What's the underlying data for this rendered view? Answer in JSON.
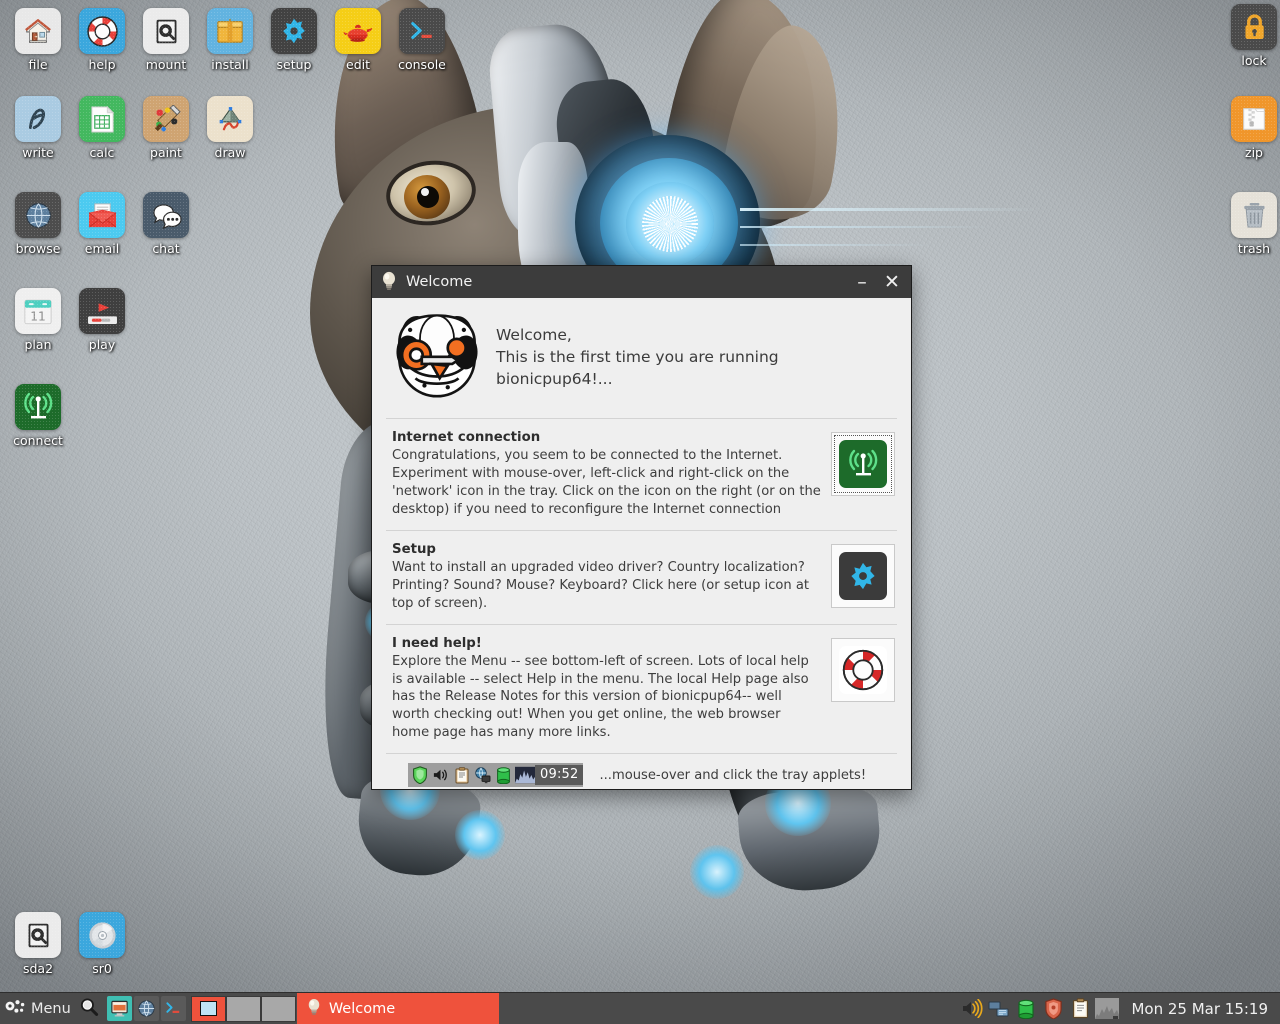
{
  "desktop": {
    "icons_left": [
      {
        "label": "file",
        "name": "desktop-icon-file",
        "icon": "home-icon",
        "bg": "#e8e8e8"
      },
      {
        "label": "help",
        "name": "desktop-icon-help",
        "icon": "lifering-icon",
        "bg": "#3ba7dd"
      },
      {
        "label": "mount",
        "name": "desktop-icon-mount",
        "icon": "harddisk-icon",
        "bg": "#ebebeb"
      },
      {
        "label": "install",
        "name": "desktop-icon-install",
        "icon": "package-icon",
        "bg": "#62b3e0"
      },
      {
        "label": "setup",
        "name": "desktop-icon-setup",
        "icon": "gear-icon",
        "bg": "#424242"
      },
      {
        "label": "edit",
        "name": "desktop-icon-edit",
        "icon": "genie-lamp-icon",
        "bg": "#f5ce17"
      },
      {
        "label": "console",
        "name": "desktop-icon-console",
        "icon": "terminal-icon",
        "bg": "#4a4a4a"
      },
      {
        "label": "write",
        "name": "desktop-icon-write",
        "icon": "pen-stroke-icon",
        "bg": "#aacbe2"
      },
      {
        "label": "calc",
        "name": "desktop-icon-calc",
        "icon": "spreadsheet-icon",
        "bg": "#43b85f"
      },
      {
        "label": "paint",
        "name": "desktop-icon-paint",
        "icon": "palette-icon",
        "bg": "#cfa472"
      },
      {
        "label": "draw",
        "name": "desktop-icon-draw",
        "icon": "vector-icon",
        "bg": "#ece1cc"
      },
      {
        "label": "browse",
        "name": "desktop-icon-browse",
        "icon": "globe-icon",
        "bg": "#4d4d4d"
      },
      {
        "label": "email",
        "name": "desktop-icon-email",
        "icon": "envelope-icon",
        "bg": "#4ccaf0"
      },
      {
        "label": "chat",
        "name": "desktop-icon-chat",
        "icon": "speech-bubble-icon",
        "bg": "#4a5b6b"
      },
      {
        "label": "plan",
        "name": "desktop-icon-plan",
        "icon": "calendar-icon",
        "bg": "#efefef"
      },
      {
        "label": "play",
        "name": "desktop-icon-play",
        "icon": "media-play-icon",
        "bg": "#3f3f3f"
      },
      {
        "label": "connect",
        "name": "desktop-icon-connect",
        "icon": "antenna-icon",
        "bg": "#1d6b2a"
      }
    ],
    "icons_right": [
      {
        "label": "lock",
        "name": "desktop-icon-lock",
        "icon": "padlock-icon",
        "bg": "#4a4a4a"
      },
      {
        "label": "zip",
        "name": "desktop-icon-zip",
        "icon": "zip-folder-icon",
        "bg": "#f0962b"
      },
      {
        "label": "trash",
        "name": "desktop-icon-trash",
        "icon": "trashcan-icon",
        "bg": "#e6e2d9"
      }
    ],
    "icons_drives": [
      {
        "label": "sda2",
        "name": "desktop-icon-sda2",
        "icon": "harddisk-icon",
        "bg": "#ebebeb"
      },
      {
        "label": "sr0",
        "name": "desktop-icon-sr0",
        "icon": "optical-disc-icon",
        "bg": "#3ba7dd"
      }
    ],
    "wallpaper_alt": "cyborg french bulldog"
  },
  "welcome": {
    "title": "Welcome",
    "title_icon": "lightbulb-icon",
    "minimize_label": "–",
    "close_label": "✕",
    "greeting_line1": "Welcome,",
    "greeting_line2": "This is the first time you are running bionicpup64!...",
    "logo_icon": "puppy-linux-logo",
    "sections": [
      {
        "heading": "Internet connection",
        "body": "Congratulations, you seem to be connected to the Internet. Experiment with mouse-over, left-click and right-click on the 'network' icon in the tray. Click on the icon on the right (or on the desktop) if you need to reconfigure the Internet connection",
        "icon": "antenna-icon",
        "icon_bg": "#1d6b2a",
        "focused": true
      },
      {
        "heading": "Setup",
        "body": "Want to install an upgraded video driver? Country localization? Printing? Sound? Mouse? Keyboard? Click here (or setup icon at top of screen).",
        "icon": "gear-icon",
        "icon_bg": "#3b3b3b",
        "focused": false
      },
      {
        "heading": "I need help!",
        "body": "Explore the Menu -- see bottom-left of screen. Lots of local help is available -- select Help in the menu. The local Help page also has the Release Notes for this version of bionicpup64-- well worth checking out! When you get online, the web browser home page has many more links.",
        "icon": "lifering-icon",
        "icon_bg": "#ffffff",
        "focused": false
      }
    ],
    "footer": {
      "tray_icons": [
        "shield-icon",
        "volume-icon",
        "clipboard-icon",
        "network-icon",
        "drive-icon",
        "cpu-graph-icon"
      ],
      "tray_clock": "09:52",
      "hint": "...mouse-over and click the tray applets!"
    }
  },
  "taskbar": {
    "menu_label": "Menu",
    "menu_icon": "puppy-paw-icon",
    "search_icon": "magnifier-icon",
    "launchers": [
      {
        "name": "taskbar-launcher-files",
        "icon": "file-manager-icon",
        "bg": "#3fbfb3"
      },
      {
        "name": "taskbar-launcher-browser",
        "icon": "globe-icon",
        "bg": "#5a5a5a"
      },
      {
        "name": "taskbar-launcher-terminal",
        "icon": "terminal-icon",
        "bg": "#5a5a5a"
      }
    ],
    "pager": [
      {
        "name": "workspace-1",
        "active": true
      },
      {
        "name": "workspace-2",
        "active": false
      },
      {
        "name": "workspace-3",
        "active": false
      }
    ],
    "tasks": [
      {
        "label": "Welcome",
        "icon": "lightbulb-icon",
        "active": true
      }
    ],
    "tray": [
      "volume-icon",
      "network-icon",
      "drive-icon",
      "shield-icon",
      "clipboard-icon",
      "cpu-graph-icon"
    ],
    "clock": "Mon 25 Mar 15:19",
    "accent_color": "#ef523c",
    "bar_color": "#4a4a4a"
  }
}
